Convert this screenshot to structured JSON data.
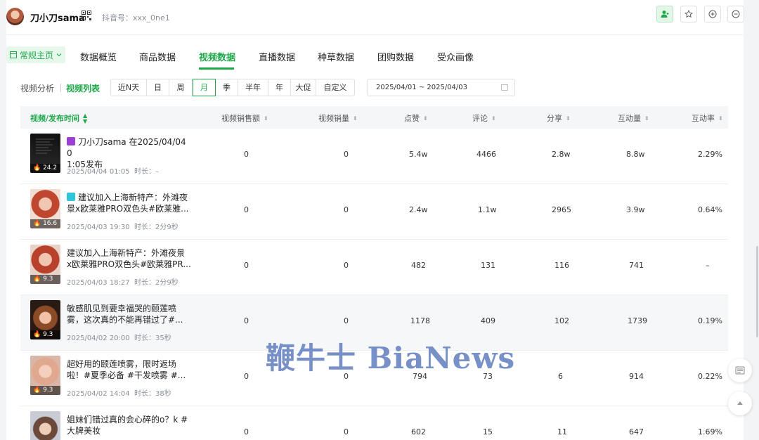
{
  "header": {
    "account_name": "刀小刀sama",
    "douyin_id": "抖音号：xxx_0ne1"
  },
  "nav": {
    "home_selector": "常规主页",
    "tabs": [
      "数据概览",
      "商品数据",
      "视频数据",
      "直播数据",
      "种草数据",
      "团购数据",
      "受众画像"
    ],
    "active_tab": "视频数据"
  },
  "filters": {
    "analysis_label": "视频分析",
    "list_label": "视频列表",
    "periods": [
      "近N天",
      "日",
      "周",
      "月",
      "季",
      "半年",
      "年",
      "大促",
      "自定义"
    ],
    "active_period": "月",
    "date_range": "2025/04/01 ~ 2025/04/03"
  },
  "table": {
    "columns": [
      "视频/发布时间",
      "视频销售额",
      "视频销量",
      "点赞",
      "评论",
      "分享",
      "互动量",
      "互动率"
    ],
    "rows": [
      {
        "score": "24.2",
        "title": "刀小刀sama 在2025/04/04 01:05发布",
        "title_line1": "刀小刀sama 在2025/04/04 0",
        "title_line2": "1:05发布",
        "publish": "2025/04/04 01:05",
        "duration_label": "时长：",
        "duration": "–",
        "sales_amount": "0",
        "sales_qty": "0",
        "likes": "5.4w",
        "comments": "4466",
        "shares": "2.8w",
        "interactions": "8.8w",
        "rate": "2.29%"
      },
      {
        "score": "16.6",
        "title_line1": "建议加入上海新特产：外滩夜",
        "title_line2": "景x欧莱雅PRO双色头#欧莱雅...",
        "publish": "2025/04/03 19:30",
        "duration_label": "时长：",
        "duration": "2分9秒",
        "sales_amount": "0",
        "sales_qty": "0",
        "likes": "2.4w",
        "comments": "1.1w",
        "shares": "2965",
        "interactions": "3.9w",
        "rate": "0.64%"
      },
      {
        "score": "9.3",
        "title_line1": "建议加入上海新特产：外滩夜景",
        "title_line2": "x欧莱雅PRO双色头#欧莱雅PR...",
        "publish": "2025/04/03 18:27",
        "duration_label": "时长：",
        "duration": "2分9秒",
        "sales_amount": "0",
        "sales_qty": "0",
        "likes": "482",
        "comments": "131",
        "shares": "116",
        "interactions": "741",
        "rate": "–"
      },
      {
        "score": "9.3",
        "title_line1": "敏感肌见到要幸福哭的颐莲喷",
        "title_line2": "雾，这次真的不能再错过了#...",
        "publish": "2025/04/02 20:00",
        "duration_label": "时长：",
        "duration": "35秒",
        "sales_amount": "0",
        "sales_qty": "0",
        "likes": "1178",
        "comments": "409",
        "shares": "102",
        "interactions": "1739",
        "rate": "0.19%"
      },
      {
        "score": "9.3",
        "title_line1": "超好用的颐莲喷雾，限时返场",
        "title_line2": "啦！#夏季必备 #干发喷雾 #...",
        "publish": "2025/04/02 14:04",
        "duration_label": "时长：",
        "duration": "38秒",
        "sales_amount": "0",
        "sales_qty": "0",
        "likes": "794",
        "comments": "73",
        "shares": "6",
        "interactions": "914",
        "rate": "0.22%"
      },
      {
        "score": "",
        "title_line1": "姐妹们错过真的会心碎的o？k #",
        "title_line2": "大牌美妆",
        "publish": "",
        "duration_label": "",
        "duration": "",
        "sales_amount": "0",
        "sales_qty": "0",
        "likes": "602",
        "comments": "15",
        "shares": "11",
        "interactions": "647",
        "rate": "1.69%"
      }
    ]
  },
  "watermark": "鞭牛士 BiaNews",
  "colors": {
    "accent": "#1fa84a",
    "watermark": "#5f7dbe"
  }
}
